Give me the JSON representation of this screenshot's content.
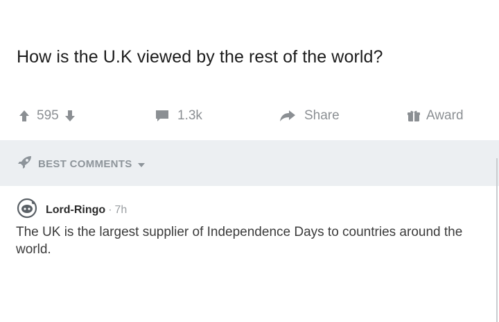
{
  "post": {
    "title": "How is the U.K viewed by the rest of the world?"
  },
  "actions": {
    "vote_count": "595",
    "comment_count": "1.3k",
    "share_label": "Share",
    "award_label": "Award"
  },
  "sort": {
    "label": "BEST COMMENTS"
  },
  "comment": {
    "username": "Lord-Ringo",
    "separator": "·",
    "time": "7h",
    "body": "The UK is the largest supplier of Independence Days to countries around the world."
  },
  "colors": {
    "text_primary": "#1b1b1b",
    "text_muted": "#8b8f93",
    "sort_bar_bg": "#eceff2"
  },
  "icons": [
    "upvote-icon",
    "downvote-icon",
    "comment-icon",
    "share-icon",
    "award-icon",
    "rocket-icon",
    "caret-down-icon",
    "avatar-icon"
  ]
}
